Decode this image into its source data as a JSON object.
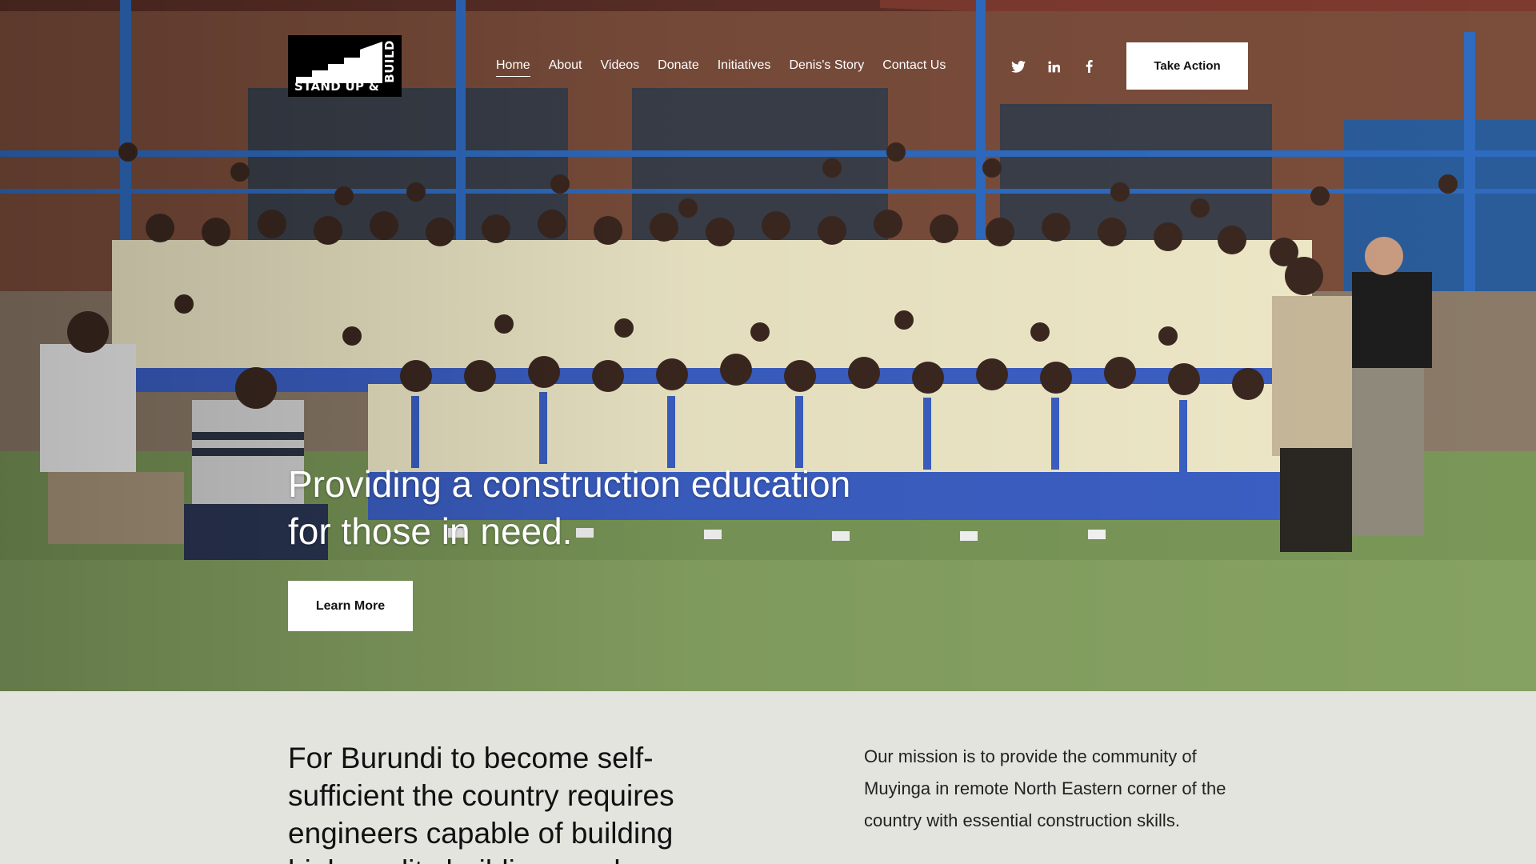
{
  "brand": {
    "logo_text": "STAND UP &",
    "logo_text_vertical": "BUILD"
  },
  "nav": {
    "items": [
      {
        "label": "Home",
        "active": true
      },
      {
        "label": "About"
      },
      {
        "label": "Videos"
      },
      {
        "label": "Donate"
      },
      {
        "label": "Initiatives"
      },
      {
        "label": "Denis's Story"
      },
      {
        "label": "Contact Us"
      }
    ]
  },
  "social": {
    "icons": [
      "twitter-icon",
      "linkedin-icon",
      "facebook-icon"
    ]
  },
  "header": {
    "cta_label": "Take Action"
  },
  "hero": {
    "title": "Providing a construction education for those in need.",
    "button_label": "Learn More"
  },
  "mission": {
    "heading": "For Burundi to become self-sufficient the country requires engineers capable of building high quality buildings and",
    "text": "Our mission is to provide the community of Muyinga in remote North Eastern corner of the country with essential construction skills."
  },
  "colors": {
    "section_bg": "#e4e4df",
    "button_bg": "#ffffff",
    "text_dark": "#111111",
    "uniform_shirt": "#efe9c8",
    "uniform_blue": "#3b5fc4",
    "railing_blue": "#2f6bc0"
  }
}
